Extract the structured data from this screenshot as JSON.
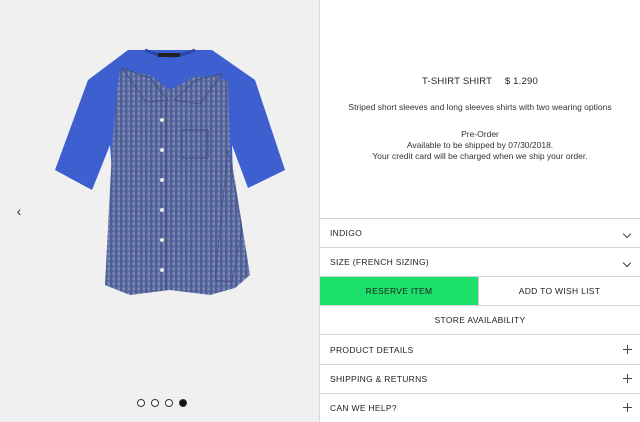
{
  "gallery": {
    "image_alt": "Striped blue shirt layered over blue t-shirt",
    "slides": [
      {
        "active": false
      },
      {
        "active": false
      },
      {
        "active": false
      },
      {
        "active": true
      }
    ],
    "prev_icon": "chevron-left-icon"
  },
  "product": {
    "name": "T-SHIRT SHIRT",
    "price": "$ 1.290",
    "description": "Striped short sleeves and long sleeves shirts with two wearing options",
    "preorder_title": "Pre-Order",
    "preorder_ship": "Available to be shipped by 07/30/2018.",
    "preorder_charge": "Your credit card will be charged when we ship your order."
  },
  "selectors": {
    "color": "INDIGO",
    "size": "SIZE (FRENCH SIZING)"
  },
  "actions": {
    "reserve": "RESERVE ITEM",
    "wishlist": "ADD TO WISH LIST",
    "store": "STORE AVAILABILITY"
  },
  "accordions": {
    "details": "PRODUCT DETAILS",
    "shipping": "SHIPPING & RETURNS",
    "help": "CAN WE HELP?"
  },
  "colors": {
    "reserve_bg": "#1de06a",
    "shirt_blue": "#3d5fd0",
    "check_blue": "#5a6fa8"
  }
}
